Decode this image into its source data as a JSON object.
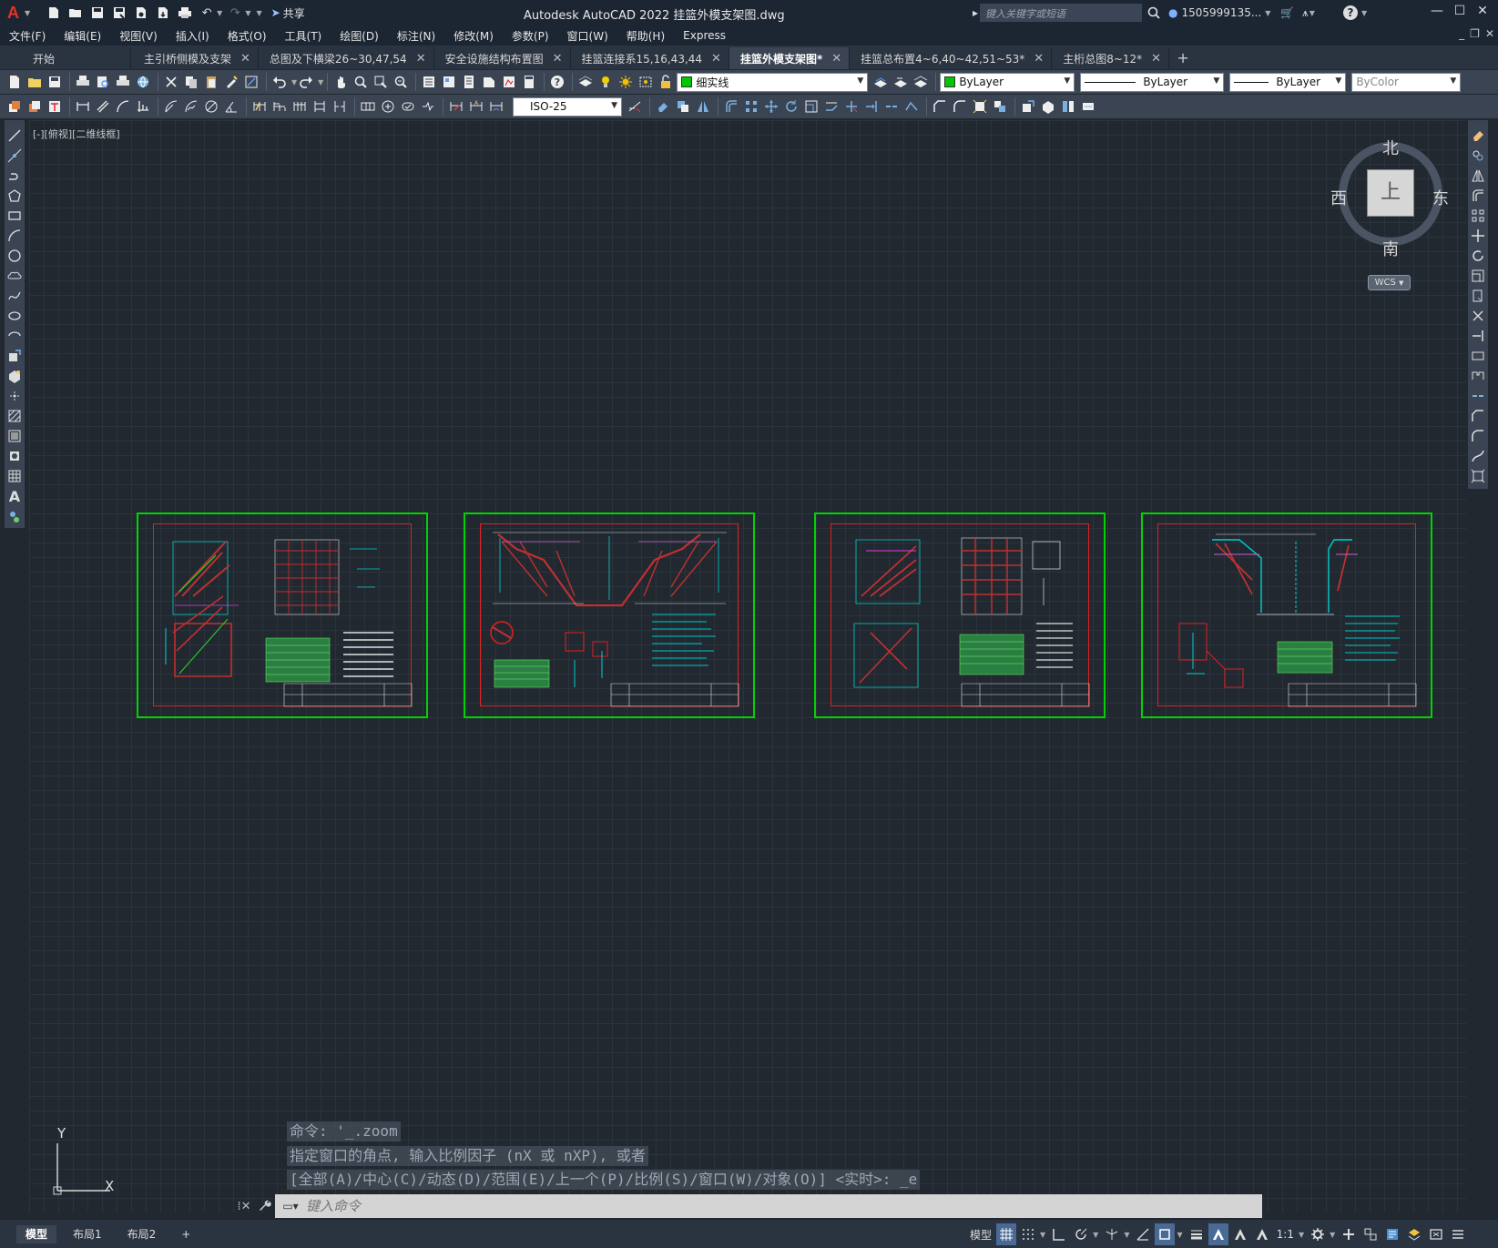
{
  "app": {
    "logo": "A",
    "window_title": "Autodesk AutoCAD 2022     挂篮外模支架图.dwg",
    "share_label": "共享",
    "search_placeholder": "键入关键字或短语",
    "user": "1505999135...",
    "help": "?"
  },
  "menu": [
    "文件(F)",
    "编辑(E)",
    "视图(V)",
    "插入(I)",
    "格式(O)",
    "工具(T)",
    "绘图(D)",
    "标注(N)",
    "修改(M)",
    "参数(P)",
    "窗口(W)",
    "帮助(H)",
    "Express"
  ],
  "tabs": [
    {
      "label": "开始",
      "closable": false,
      "active": false
    },
    {
      "label": "主引桥侧模及支架",
      "closable": true,
      "active": false
    },
    {
      "label": "总图及下横梁26~30,47,54",
      "closable": true,
      "active": false
    },
    {
      "label": "安全设施结构布置图",
      "closable": true,
      "active": false
    },
    {
      "label": "挂篮连接系15,16,43,44",
      "closable": true,
      "active": false
    },
    {
      "label": "挂篮外模支架图*",
      "closable": true,
      "active": true
    },
    {
      "label": "挂篮总布置4~6,40~42,51~53*",
      "closable": true,
      "active": false
    },
    {
      "label": "主桁总图8~12*",
      "closable": true,
      "active": false
    }
  ],
  "properties": {
    "layer": "细实线",
    "color": "ByLayer",
    "linetype": "ByLayer",
    "lineweight": "ByLayer",
    "plotstyle": "ByColor",
    "dimstyle": "ISO-25"
  },
  "viewport": {
    "label": "[-][俯视][二维线框]"
  },
  "viewcube": {
    "north": "北",
    "south": "南",
    "east": "东",
    "west": "西",
    "top": "上",
    "wcs": "WCS"
  },
  "ucs": {
    "x": "X",
    "y": "Y"
  },
  "command": {
    "history": [
      "命令: '_.zoom",
      "指定窗口的角点, 输入比例因子 (nX 或 nXP), 或者",
      "[全部(A)/中心(C)/动态(D)/范围(E)/上一个(P)/比例(S)/窗口(W)/对象(O)] <实时>: _e"
    ],
    "placeholder": "键入命令"
  },
  "layouts": [
    "模型",
    "布局1",
    "布局2"
  ],
  "status": {
    "model": "模型",
    "scale": "1:1"
  },
  "colors": {
    "sheet_border": "#00d400",
    "frame": "#e02020",
    "accent": "#4a6a96"
  }
}
